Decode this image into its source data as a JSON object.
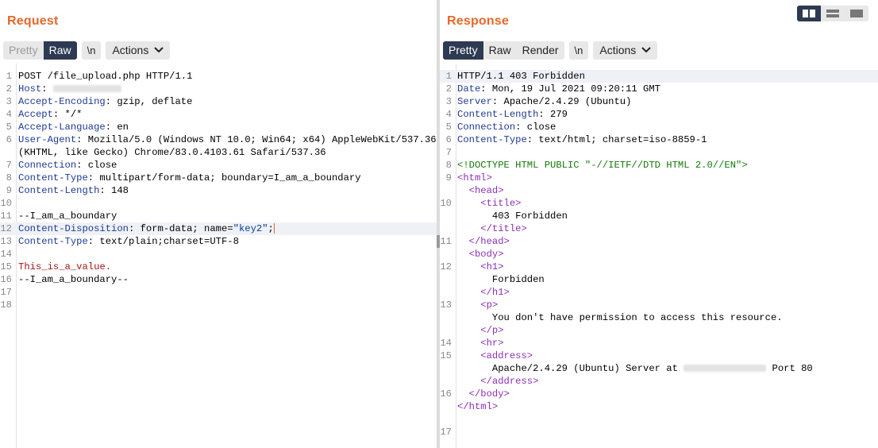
{
  "request": {
    "title": "Request",
    "tabs": {
      "pretty": "Pretty",
      "raw": "Raw",
      "newline": "\\n",
      "actions": "Actions"
    },
    "lines": [
      {
        "n": "1",
        "parts": [
          [
            "",
            "POST /file_upload.php HTTP/1.1"
          ]
        ]
      },
      {
        "n": "2",
        "parts": [
          [
            "k",
            "Host"
          ],
          [
            "",
            ": "
          ],
          [
            "blur",
            "86"
          ]
        ]
      },
      {
        "n": "3",
        "parts": [
          [
            "k",
            "Accept-Encoding"
          ],
          [
            "",
            ": gzip, deflate"
          ]
        ]
      },
      {
        "n": "4",
        "parts": [
          [
            "k",
            "Accept"
          ],
          [
            "",
            ": */*"
          ]
        ]
      },
      {
        "n": "5",
        "parts": [
          [
            "k",
            "Accept-Language"
          ],
          [
            "",
            ": en"
          ]
        ]
      },
      {
        "n": "6",
        "parts": [
          [
            "k",
            "User-Agent"
          ],
          [
            "",
            ": Mozilla/5.0 (Windows NT 10.0; Win64; x64) AppleWebKit/537.36"
          ]
        ]
      },
      {
        "n": "",
        "parts": [
          [
            "",
            "(KHTML, like Gecko) Chrome/83.0.4103.61 Safari/537.36"
          ]
        ]
      },
      {
        "n": "7",
        "parts": [
          [
            "k",
            "Connection"
          ],
          [
            "",
            ": close"
          ]
        ]
      },
      {
        "n": "8",
        "parts": [
          [
            "k",
            "Content-Type"
          ],
          [
            "",
            ": multipart/form-data; boundary=I_am_a_boundary"
          ]
        ]
      },
      {
        "n": "9",
        "parts": [
          [
            "k",
            "Content-Length"
          ],
          [
            "",
            ": 148"
          ]
        ]
      },
      {
        "n": "10",
        "parts": []
      },
      {
        "n": "11",
        "parts": [
          [
            "",
            "--I_am_a_boundary"
          ]
        ]
      },
      {
        "n": "12",
        "hl": true,
        "parts": [
          [
            "k",
            "Content-Disposition"
          ],
          [
            "",
            ": form-data; name="
          ],
          [
            "s",
            "\"key2\""
          ],
          [
            "",
            ";"
          ],
          [
            "caret",
            ""
          ]
        ]
      },
      {
        "n": "13",
        "parts": [
          [
            "k",
            "Content-Type"
          ],
          [
            "",
            ": text/plain;charset=UTF-8"
          ]
        ]
      },
      {
        "n": "14",
        "parts": []
      },
      {
        "n": "15",
        "parts": [
          [
            "v",
            "This_is_a_value."
          ]
        ]
      },
      {
        "n": "16",
        "parts": [
          [
            "",
            "--I_am_a_boundary--"
          ]
        ]
      },
      {
        "n": "17",
        "parts": []
      },
      {
        "n": "18",
        "parts": []
      }
    ]
  },
  "response": {
    "title": "Response",
    "tabs": {
      "pretty": "Pretty",
      "raw": "Raw",
      "render": "Render",
      "newline": "\\n",
      "actions": "Actions"
    },
    "lines": [
      {
        "n": "1",
        "hl": true,
        "parts": [
          [
            "",
            "HTTP/1.1 403 Forbidden"
          ]
        ]
      },
      {
        "n": "2",
        "parts": [
          [
            "k",
            "Date"
          ],
          [
            "",
            ": Mon, 19 Jul 2021 09:20:11 GMT"
          ]
        ]
      },
      {
        "n": "3",
        "parts": [
          [
            "k",
            "Server"
          ],
          [
            "",
            ": Apache/2.4.29 (Ubuntu)"
          ]
        ]
      },
      {
        "n": "4",
        "parts": [
          [
            "k",
            "Content-Length"
          ],
          [
            "",
            ": 279"
          ]
        ]
      },
      {
        "n": "5",
        "parts": [
          [
            "k",
            "Connection"
          ],
          [
            "",
            ": close"
          ]
        ]
      },
      {
        "n": "6",
        "parts": [
          [
            "k",
            "Content-Type"
          ],
          [
            "",
            ": text/html; charset=iso-8859-1"
          ]
        ]
      },
      {
        "n": "7",
        "parts": []
      },
      {
        "n": "8",
        "parts": [
          [
            "cm",
            "<!DOCTYPE HTML PUBLIC \"-//IETF//DTD HTML 2.0//EN\">"
          ]
        ]
      },
      {
        "n": "9",
        "parts": [
          [
            "t",
            "<html>"
          ]
        ]
      },
      {
        "n": "",
        "parts": [
          [
            "",
            "  "
          ],
          [
            "t",
            "<head>"
          ]
        ]
      },
      {
        "n": "10",
        "parts": [
          [
            "",
            "    "
          ],
          [
            "t",
            "<title>"
          ]
        ]
      },
      {
        "n": "",
        "parts": [
          [
            "",
            "      403 Forbidden"
          ]
        ]
      },
      {
        "n": "",
        "parts": [
          [
            "",
            "    "
          ],
          [
            "t",
            "</title>"
          ]
        ]
      },
      {
        "n": "11",
        "parts": [
          [
            "",
            "  "
          ],
          [
            "t",
            "</head>"
          ]
        ]
      },
      {
        "n": "",
        "parts": [
          [
            "",
            "  "
          ],
          [
            "t",
            "<body>"
          ]
        ]
      },
      {
        "n": "12",
        "parts": [
          [
            "",
            "    "
          ],
          [
            "t",
            "<h1>"
          ]
        ]
      },
      {
        "n": "",
        "parts": [
          [
            "",
            "      Forbidden"
          ]
        ]
      },
      {
        "n": "",
        "parts": [
          [
            "",
            "    "
          ],
          [
            "t",
            "</h1>"
          ]
        ]
      },
      {
        "n": "13",
        "parts": [
          [
            "",
            "    "
          ],
          [
            "t",
            "<p>"
          ]
        ]
      },
      {
        "n": "",
        "parts": [
          [
            "",
            "      You don't have permission to access this resource."
          ]
        ]
      },
      {
        "n": "",
        "parts": [
          [
            "",
            "    "
          ],
          [
            "t",
            "</p>"
          ]
        ]
      },
      {
        "n": "14",
        "parts": [
          [
            "",
            "    "
          ],
          [
            "t",
            "<hr>"
          ]
        ]
      },
      {
        "n": "15",
        "parts": [
          [
            "",
            "    "
          ],
          [
            "t",
            "<address>"
          ]
        ]
      },
      {
        "n": "",
        "parts": [
          [
            "",
            "      Apache/2.4.29 (Ubuntu) Server at "
          ],
          [
            "blur",
            "104"
          ],
          [
            "",
            " Port 80"
          ]
        ]
      },
      {
        "n": "",
        "parts": [
          [
            "",
            "    "
          ],
          [
            "t",
            "</address>"
          ]
        ]
      },
      {
        "n": "16",
        "parts": [
          [
            "",
            "  "
          ],
          [
            "t",
            "</body>"
          ]
        ]
      },
      {
        "n": "",
        "parts": [
          [
            "t",
            "</html>"
          ]
        ]
      },
      {
        "n": "",
        "parts": []
      },
      {
        "n": "17",
        "parts": []
      }
    ]
  },
  "colors": {
    "accent": "#e8672a",
    "active_tab": "#2d3a52"
  },
  "layout_switch": [
    "split-horizontal-icon",
    "split-vertical-icon",
    "single-pane-icon"
  ]
}
